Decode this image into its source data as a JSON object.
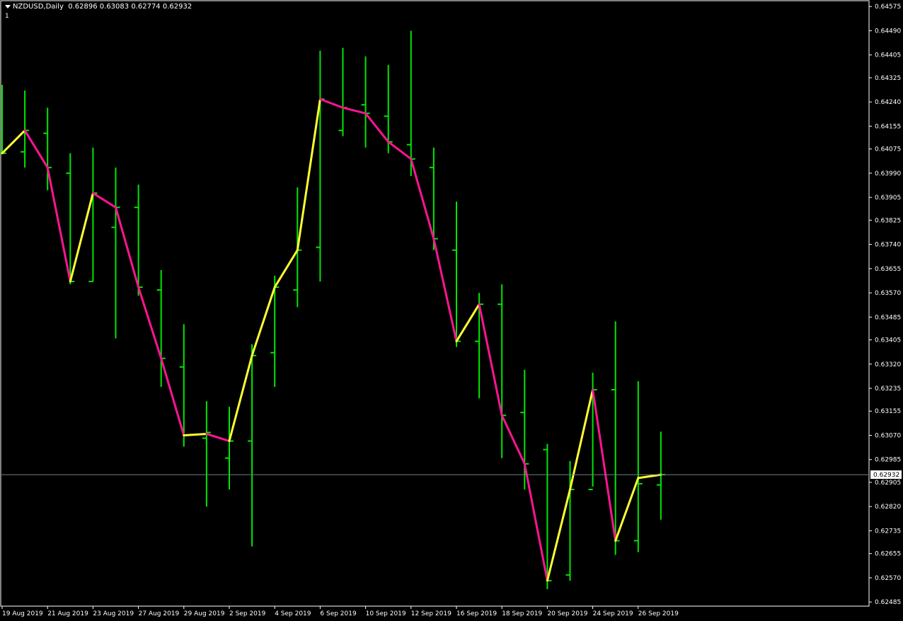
{
  "header": {
    "symbol_timeframe": "NZDUSD,Daily",
    "ohlc": "0.62896 0.63083 0.62774 0.62932",
    "window_index": "1"
  },
  "colors": {
    "background": "#000000",
    "frame": "#ffffff",
    "bar": "#00e600",
    "zigzag_up": "#ffff33",
    "zigzag_down": "#ff1493",
    "price_line": "#708090"
  },
  "chart_data": {
    "type": "ohlc",
    "symbol": "NZDUSD",
    "timeframe": "Daily",
    "current_price": "0.62932",
    "ylim": [
      0.62468,
      0.64578
    ],
    "y_ticks": [
      "0.64575",
      "0.64490",
      "0.64405",
      "0.64325",
      "0.64240",
      "0.64155",
      "0.64075",
      "0.63990",
      "0.63905",
      "0.63825",
      "0.63740",
      "0.63655",
      "0.63570",
      "0.63485",
      "0.63405",
      "0.63320",
      "0.63235",
      "0.63155",
      "0.63070",
      "0.62985",
      "0.62905",
      "0.62820",
      "0.62735",
      "0.62655",
      "0.62570",
      "0.62485"
    ],
    "x_labels": [
      {
        "text": "19 Aug 2019",
        "bar": 0
      },
      {
        "text": "21 Aug 2019",
        "bar": 2
      },
      {
        "text": "23 Aug 2019",
        "bar": 4
      },
      {
        "text": "27 Aug 2019",
        "bar": 6
      },
      {
        "text": "29 Aug 2019",
        "bar": 8
      },
      {
        "text": "2 Sep 2019",
        "bar": 10
      },
      {
        "text": "4 Sep 2019",
        "bar": 12
      },
      {
        "text": "6 Sep 2019",
        "bar": 14
      },
      {
        "text": "10 Sep 2019",
        "bar": 16
      },
      {
        "text": "12 Sep 2019",
        "bar": 18
      },
      {
        "text": "16 Sep 2019",
        "bar": 20
      },
      {
        "text": "18 Sep 2019",
        "bar": 22
      },
      {
        "text": "20 Sep 2019",
        "bar": 24
      },
      {
        "text": "24 Sep 2019",
        "bar": 26
      },
      {
        "text": "26 Sep 2019",
        "bar": 28
      }
    ],
    "bars": [
      {
        "o": 0.6406,
        "h": 0.643,
        "l": 0.6406,
        "c": 0.6406
      },
      {
        "o": 0.64065,
        "h": 0.6428,
        "l": 0.6401,
        "c": 0.6414
      },
      {
        "o": 0.6413,
        "h": 0.6422,
        "l": 0.6393,
        "c": 0.6401
      },
      {
        "o": 0.6399,
        "h": 0.6406,
        "l": 0.636,
        "c": 0.6361
      },
      {
        "o": 0.6361,
        "h": 0.6408,
        "l": 0.6361,
        "c": 0.6392
      },
      {
        "o": 0.638,
        "h": 0.6401,
        "l": 0.6341,
        "c": 0.6387
      },
      {
        "o": 0.6387,
        "h": 0.6395,
        "l": 0.6356,
        "c": 0.6359
      },
      {
        "o": 0.6358,
        "h": 0.6365,
        "l": 0.6324,
        "c": 0.6334
      },
      {
        "o": 0.6331,
        "h": 0.6346,
        "l": 0.6303,
        "c": 0.6307
      },
      {
        "o": 0.6306,
        "h": 0.6319,
        "l": 0.6282,
        "c": 0.6308
      },
      {
        "o": 0.6299,
        "h": 0.6317,
        "l": 0.6288,
        "c": 0.6305
      },
      {
        "o": 0.6305,
        "h": 0.6339,
        "l": 0.6268,
        "c": 0.6335
      },
      {
        "o": 0.6336,
        "h": 0.6363,
        "l": 0.6324,
        "c": 0.6359
      },
      {
        "o": 0.6358,
        "h": 0.6394,
        "l": 0.6352,
        "c": 0.6372
      },
      {
        "o": 0.6373,
        "h": 0.6442,
        "l": 0.6361,
        "c": 0.6425
      },
      {
        "o": 0.6414,
        "h": 0.6443,
        "l": 0.6412,
        "c": 0.6422
      },
      {
        "o": 0.6423,
        "h": 0.644,
        "l": 0.6408,
        "c": 0.642
      },
      {
        "o": 0.6419,
        "h": 0.6437,
        "l": 0.6406,
        "c": 0.641
      },
      {
        "o": 0.6409,
        "h": 0.6449,
        "l": 0.6398,
        "c": 0.6404
      },
      {
        "o": 0.6401,
        "h": 0.6408,
        "l": 0.6372,
        "c": 0.6376
      },
      {
        "o": 0.6372,
        "h": 0.6389,
        "l": 0.6338,
        "c": 0.634
      },
      {
        "o": 0.634,
        "h": 0.6357,
        "l": 0.632,
        "c": 0.6353
      },
      {
        "o": 0.6353,
        "h": 0.636,
        "l": 0.6299,
        "c": 0.6314
      },
      {
        "o": 0.6315,
        "h": 0.633,
        "l": 0.6288,
        "c": 0.6297
      },
      {
        "o": 0.6302,
        "h": 0.6304,
        "l": 0.6253,
        "c": 0.6256
      },
      {
        "o": 0.6258,
        "h": 0.6298,
        "l": 0.6256,
        "c": 0.6288
      },
      {
        "o": 0.6288,
        "h": 0.6329,
        "l": 0.6289,
        "c": 0.6323
      },
      {
        "o": 0.6323,
        "h": 0.6347,
        "l": 0.6265,
        "c": 0.627
      },
      {
        "o": 0.627,
        "h": 0.6326,
        "l": 0.6266,
        "c": 0.629
      },
      {
        "o": 0.62896,
        "h": 0.63083,
        "l": 0.62774,
        "c": 0.62932
      }
    ],
    "zigzag": [
      {
        "bar": 0,
        "price": 0.6406
      },
      {
        "bar": 1,
        "price": 0.6414
      },
      {
        "bar": 2,
        "price": 0.6401
      },
      {
        "bar": 3,
        "price": 0.6361
      },
      {
        "bar": 4,
        "price": 0.6392
      },
      {
        "bar": 5,
        "price": 0.6387
      },
      {
        "bar": 6,
        "price": 0.6359
      },
      {
        "bar": 7,
        "price": 0.6334
      },
      {
        "bar": 8,
        "price": 0.6307
      },
      {
        "bar": 9,
        "price": 0.63075
      },
      {
        "bar": 10,
        "price": 0.6305
      },
      {
        "bar": 11,
        "price": 0.6335
      },
      {
        "bar": 12,
        "price": 0.6359
      },
      {
        "bar": 13,
        "price": 0.6372
      },
      {
        "bar": 14,
        "price": 0.6425
      },
      {
        "bar": 15,
        "price": 0.6422
      },
      {
        "bar": 16,
        "price": 0.642
      },
      {
        "bar": 17,
        "price": 0.641
      },
      {
        "bar": 18,
        "price": 0.6404
      },
      {
        "bar": 19,
        "price": 0.6376
      },
      {
        "bar": 20,
        "price": 0.634
      },
      {
        "bar": 21,
        "price": 0.6353
      },
      {
        "bar": 22,
        "price": 0.6314
      },
      {
        "bar": 23,
        "price": 0.6297
      },
      {
        "bar": 24,
        "price": 0.6256
      },
      {
        "bar": 25,
        "price": 0.6288
      },
      {
        "bar": 26,
        "price": 0.6323
      },
      {
        "bar": 27,
        "price": 0.627
      },
      {
        "bar": 28,
        "price": 0.6292
      },
      {
        "bar": 29,
        "price": 0.62932
      }
    ]
  }
}
